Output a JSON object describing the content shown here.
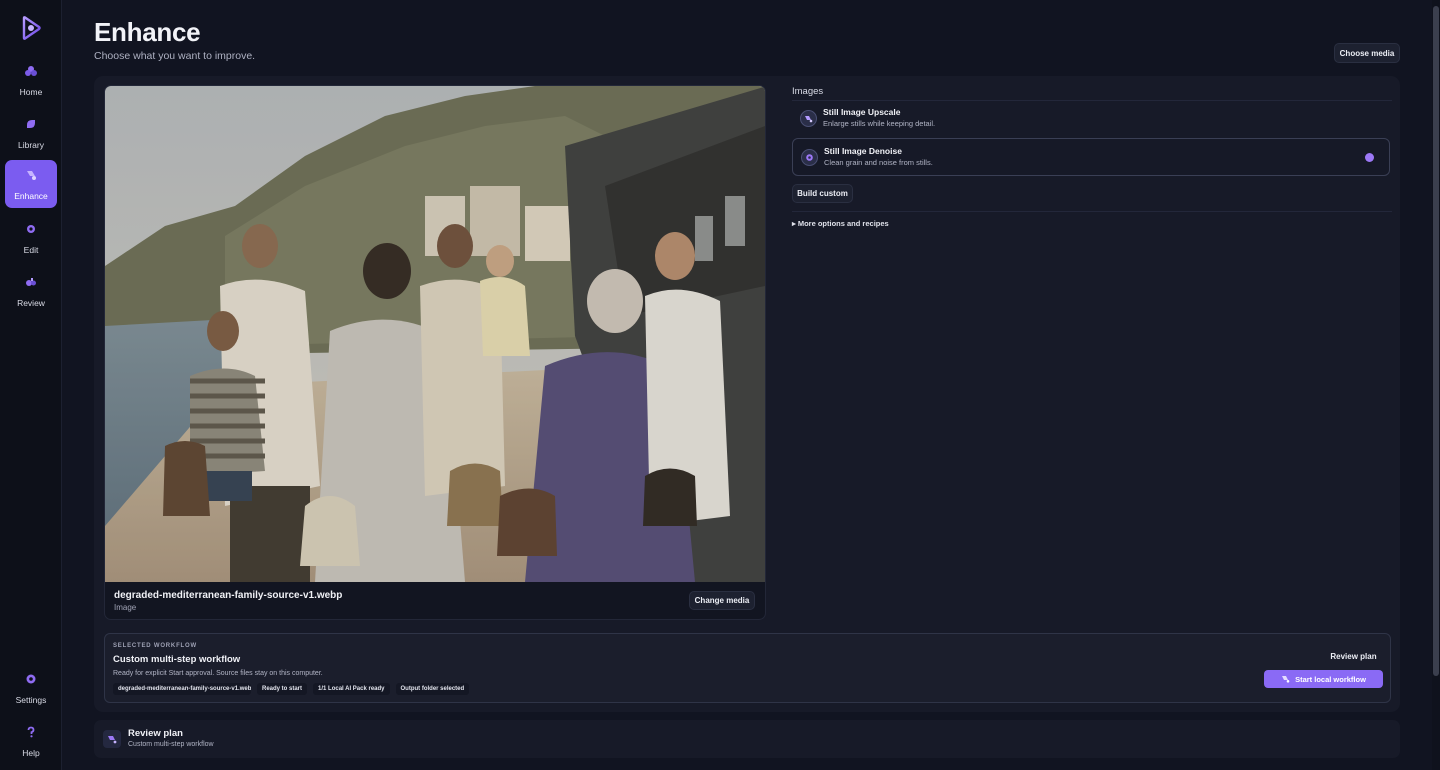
{
  "sidebar": {
    "logo_icon": "play-logo-icon",
    "items": [
      {
        "label": "Home",
        "icon": "home-icon"
      },
      {
        "label": "Library",
        "icon": "library-icon"
      },
      {
        "label": "Enhance",
        "icon": "enhance-icon",
        "active": true
      },
      {
        "label": "Edit",
        "icon": "edit-icon"
      },
      {
        "label": "Review",
        "icon": "review-icon"
      }
    ],
    "bottom_items": [
      {
        "label": "Settings",
        "icon": "gear-icon"
      },
      {
        "label": "Help",
        "icon": "help-icon"
      }
    ]
  },
  "header": {
    "title": "Enhance",
    "subtitle": "Choose what you want to improve.",
    "choose_media_label": "Choose media"
  },
  "media": {
    "file_name": "degraded-mediterranean-family-source-v1.webp",
    "file_type": "Image",
    "change_media_label": "Change media"
  },
  "options_panel": {
    "section_label": "Images",
    "options": [
      {
        "title": "Still Image Upscale",
        "description": "Enlarge stills while keeping detail.",
        "selected": false
      },
      {
        "title": "Still Image Denoise",
        "description": "Clean grain and noise from stills.",
        "selected": true
      }
    ],
    "build_custom_label": "Build custom",
    "more_options_label": "▸ More options and recipes"
  },
  "workflow": {
    "label": "SELECTED WORKFLOW",
    "title": "Custom multi-step workflow",
    "description": "Ready for explicit Start approval. Source files stay on this computer.",
    "chips": [
      "degraded-mediterranean-family-source-v1.webp",
      "Ready to start",
      "1/1 Local AI Pack ready",
      "Output folder selected"
    ],
    "review_plan_label": "Review plan",
    "start_label": "Start local workflow"
  },
  "review_bar": {
    "title": "Review plan",
    "subtitle": "Custom multi-step workflow"
  },
  "colors": {
    "accent": "#7b5cf0",
    "background": "#111421",
    "panel": "#171a28"
  }
}
